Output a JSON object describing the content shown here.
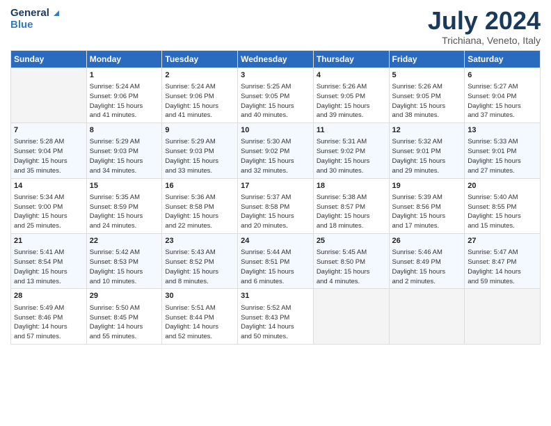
{
  "logo": {
    "line1": "General",
    "line2": "Blue"
  },
  "title": "July 2024",
  "subtitle": "Trichiana, Veneto, Italy",
  "weekdays": [
    "Sunday",
    "Monday",
    "Tuesday",
    "Wednesday",
    "Thursday",
    "Friday",
    "Saturday"
  ],
  "weeks": [
    [
      {
        "day": "",
        "info": ""
      },
      {
        "day": "1",
        "info": "Sunrise: 5:24 AM\nSunset: 9:06 PM\nDaylight: 15 hours\nand 41 minutes."
      },
      {
        "day": "2",
        "info": "Sunrise: 5:24 AM\nSunset: 9:06 PM\nDaylight: 15 hours\nand 41 minutes."
      },
      {
        "day": "3",
        "info": "Sunrise: 5:25 AM\nSunset: 9:05 PM\nDaylight: 15 hours\nand 40 minutes."
      },
      {
        "day": "4",
        "info": "Sunrise: 5:26 AM\nSunset: 9:05 PM\nDaylight: 15 hours\nand 39 minutes."
      },
      {
        "day": "5",
        "info": "Sunrise: 5:26 AM\nSunset: 9:05 PM\nDaylight: 15 hours\nand 38 minutes."
      },
      {
        "day": "6",
        "info": "Sunrise: 5:27 AM\nSunset: 9:04 PM\nDaylight: 15 hours\nand 37 minutes."
      }
    ],
    [
      {
        "day": "7",
        "info": "Sunrise: 5:28 AM\nSunset: 9:04 PM\nDaylight: 15 hours\nand 35 minutes."
      },
      {
        "day": "8",
        "info": "Sunrise: 5:29 AM\nSunset: 9:03 PM\nDaylight: 15 hours\nand 34 minutes."
      },
      {
        "day": "9",
        "info": "Sunrise: 5:29 AM\nSunset: 9:03 PM\nDaylight: 15 hours\nand 33 minutes."
      },
      {
        "day": "10",
        "info": "Sunrise: 5:30 AM\nSunset: 9:02 PM\nDaylight: 15 hours\nand 32 minutes."
      },
      {
        "day": "11",
        "info": "Sunrise: 5:31 AM\nSunset: 9:02 PM\nDaylight: 15 hours\nand 30 minutes."
      },
      {
        "day": "12",
        "info": "Sunrise: 5:32 AM\nSunset: 9:01 PM\nDaylight: 15 hours\nand 29 minutes."
      },
      {
        "day": "13",
        "info": "Sunrise: 5:33 AM\nSunset: 9:01 PM\nDaylight: 15 hours\nand 27 minutes."
      }
    ],
    [
      {
        "day": "14",
        "info": "Sunrise: 5:34 AM\nSunset: 9:00 PM\nDaylight: 15 hours\nand 25 minutes."
      },
      {
        "day": "15",
        "info": "Sunrise: 5:35 AM\nSunset: 8:59 PM\nDaylight: 15 hours\nand 24 minutes."
      },
      {
        "day": "16",
        "info": "Sunrise: 5:36 AM\nSunset: 8:58 PM\nDaylight: 15 hours\nand 22 minutes."
      },
      {
        "day": "17",
        "info": "Sunrise: 5:37 AM\nSunset: 8:58 PM\nDaylight: 15 hours\nand 20 minutes."
      },
      {
        "day": "18",
        "info": "Sunrise: 5:38 AM\nSunset: 8:57 PM\nDaylight: 15 hours\nand 18 minutes."
      },
      {
        "day": "19",
        "info": "Sunrise: 5:39 AM\nSunset: 8:56 PM\nDaylight: 15 hours\nand 17 minutes."
      },
      {
        "day": "20",
        "info": "Sunrise: 5:40 AM\nSunset: 8:55 PM\nDaylight: 15 hours\nand 15 minutes."
      }
    ],
    [
      {
        "day": "21",
        "info": "Sunrise: 5:41 AM\nSunset: 8:54 PM\nDaylight: 15 hours\nand 13 minutes."
      },
      {
        "day": "22",
        "info": "Sunrise: 5:42 AM\nSunset: 8:53 PM\nDaylight: 15 hours\nand 10 minutes."
      },
      {
        "day": "23",
        "info": "Sunrise: 5:43 AM\nSunset: 8:52 PM\nDaylight: 15 hours\nand 8 minutes."
      },
      {
        "day": "24",
        "info": "Sunrise: 5:44 AM\nSunset: 8:51 PM\nDaylight: 15 hours\nand 6 minutes."
      },
      {
        "day": "25",
        "info": "Sunrise: 5:45 AM\nSunset: 8:50 PM\nDaylight: 15 hours\nand 4 minutes."
      },
      {
        "day": "26",
        "info": "Sunrise: 5:46 AM\nSunset: 8:49 PM\nDaylight: 15 hours\nand 2 minutes."
      },
      {
        "day": "27",
        "info": "Sunrise: 5:47 AM\nSunset: 8:47 PM\nDaylight: 14 hours\nand 59 minutes."
      }
    ],
    [
      {
        "day": "28",
        "info": "Sunrise: 5:49 AM\nSunset: 8:46 PM\nDaylight: 14 hours\nand 57 minutes."
      },
      {
        "day": "29",
        "info": "Sunrise: 5:50 AM\nSunset: 8:45 PM\nDaylight: 14 hours\nand 55 minutes."
      },
      {
        "day": "30",
        "info": "Sunrise: 5:51 AM\nSunset: 8:44 PM\nDaylight: 14 hours\nand 52 minutes."
      },
      {
        "day": "31",
        "info": "Sunrise: 5:52 AM\nSunset: 8:43 PM\nDaylight: 14 hours\nand 50 minutes."
      },
      {
        "day": "",
        "info": ""
      },
      {
        "day": "",
        "info": ""
      },
      {
        "day": "",
        "info": ""
      }
    ]
  ]
}
